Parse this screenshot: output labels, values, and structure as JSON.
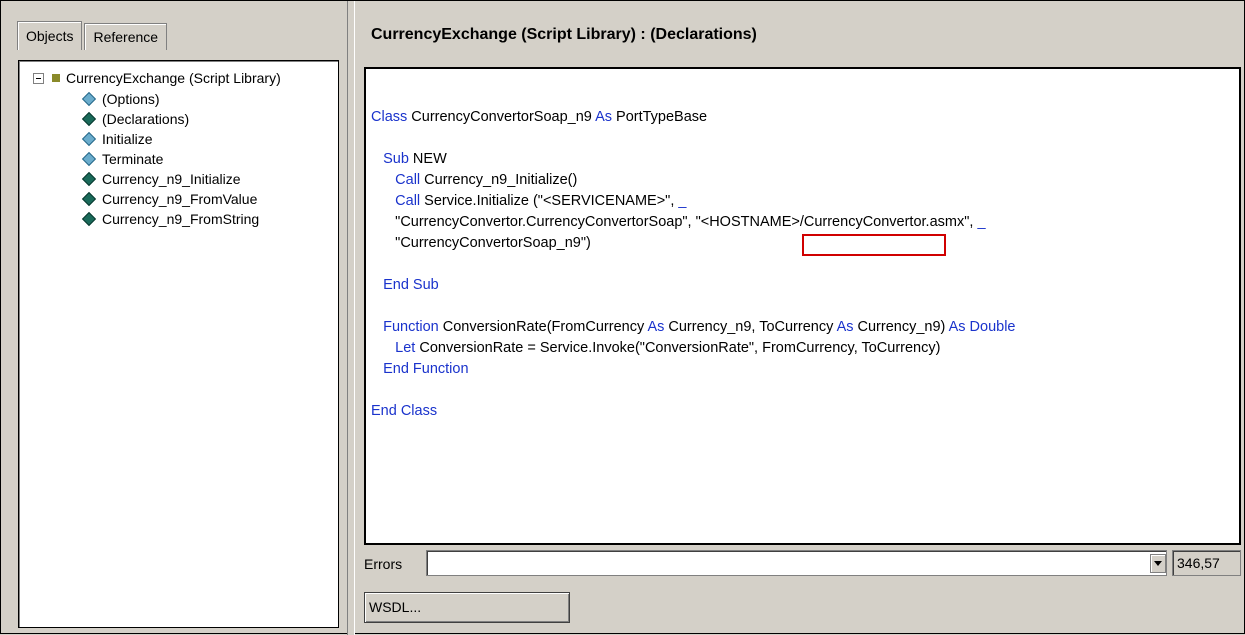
{
  "tabs": [
    {
      "label": "Objects",
      "active": true
    },
    {
      "label": "Reference",
      "active": false
    }
  ],
  "tree": {
    "root_label": "CurrencyExchange (Script Library)",
    "items": [
      {
        "label": "(Options)",
        "icon": "options-diamond-icon",
        "style": "light"
      },
      {
        "label": "(Declarations)",
        "icon": "declarations-diamond-icon",
        "style": "dark"
      },
      {
        "label": "Initialize",
        "icon": "initialize-diamond-icon",
        "style": "light"
      },
      {
        "label": "Terminate",
        "icon": "terminate-diamond-icon",
        "style": "light"
      },
      {
        "label": "Currency_n9_Initialize",
        "icon": "function-diamond-icon",
        "style": "dark"
      },
      {
        "label": "Currency_n9_FromValue",
        "icon": "function-diamond-icon",
        "style": "dark"
      },
      {
        "label": "Currency_n9_FromString",
        "icon": "function-diamond-icon",
        "style": "dark"
      }
    ]
  },
  "editor": {
    "title": "CurrencyExchange (Script Library) : (Declarations)",
    "code_lines": [
      [
        {
          "t": "Class",
          "k": true
        },
        {
          "t": " CurrencyConvertorSoap_n9 "
        },
        {
          "t": "As",
          "k": true
        },
        {
          "t": " PortTypeBase"
        }
      ],
      [],
      [
        {
          "t": "   "
        },
        {
          "t": "Sub",
          "k": true
        },
        {
          "t": " NEW"
        }
      ],
      [
        {
          "t": "      "
        },
        {
          "t": "Call",
          "k": true
        },
        {
          "t": " Currency_n9_Initialize()"
        }
      ],
      [
        {
          "t": "      "
        },
        {
          "t": "Call",
          "k": true
        },
        {
          "t": " Service.Initialize (\"<SERVICENAME>\", "
        },
        {
          "t": "_",
          "k": true
        }
      ],
      [
        {
          "t": "      \"CurrencyConvertor.CurrencyConvertorSoap\", \"<HOSTNAME>/CurrencyConvertor.asmx\", "
        },
        {
          "t": "_",
          "k": true
        }
      ],
      [
        {
          "t": "      \"CurrencyConvertorSoap_n9\")"
        }
      ],
      [],
      [
        {
          "t": "   "
        },
        {
          "t": "End Sub",
          "k": true
        }
      ],
      [],
      [
        {
          "t": "   "
        },
        {
          "t": "Function",
          "k": true
        },
        {
          "t": " ConversionRate(FromCurrency "
        },
        {
          "t": "As",
          "k": true
        },
        {
          "t": " Currency_n9, ToCurrency "
        },
        {
          "t": "As",
          "k": true
        },
        {
          "t": " Currency_n9) "
        },
        {
          "t": "As Double",
          "k": true
        }
      ],
      [
        {
          "t": "      "
        },
        {
          "t": "Let",
          "k": true
        },
        {
          "t": " ConversionRate = Service.Invoke(\"ConversionRate\", FromCurrency, ToCurrency)"
        }
      ],
      [
        {
          "t": "   "
        },
        {
          "t": "End Function",
          "k": true
        }
      ],
      [],
      [
        {
          "t": "End Class",
          "k": true
        }
      ]
    ],
    "highlight_text": "\"<HOSTNAME>"
  },
  "errors": {
    "label": "Errors",
    "value": "",
    "position": "346,57"
  },
  "buttons": {
    "wsdl_label": "WSDL..."
  },
  "colors": {
    "keyword": "#1a33cc",
    "highlight_border": "#d00000",
    "background": "#d4d0c8"
  }
}
